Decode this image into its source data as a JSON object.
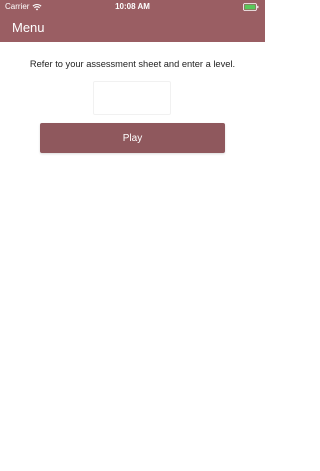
{
  "status_bar": {
    "carrier": "Carrier",
    "time": "10:08 AM",
    "wifi_icon": "wifi-icon",
    "battery_icon": "battery-icon"
  },
  "nav": {
    "menu_label": "Menu"
  },
  "main": {
    "instruction": "Refer to your assessment sheet and enter a level.",
    "level_input_value": "",
    "play_label": "Play"
  },
  "colors": {
    "header": "#9a5e63",
    "play_button": "#8f585d",
    "battery": "#5ac85a"
  }
}
